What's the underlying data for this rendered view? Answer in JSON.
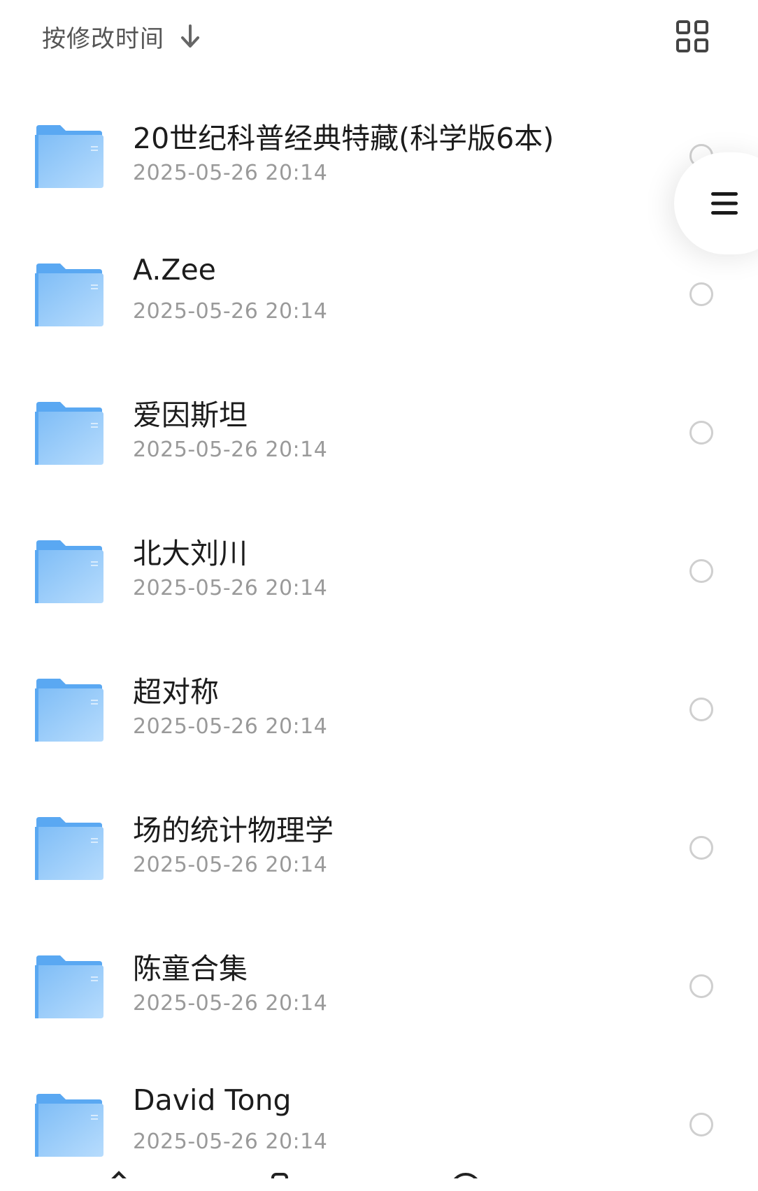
{
  "sort": {
    "label": "按修改时间",
    "direction_icon": "arrow-down-icon"
  },
  "toolbar": {
    "view_toggle_icon": "grid-view-icon"
  },
  "side_menu": {
    "icon": "hamburger-menu-icon"
  },
  "colors": {
    "folder_front_top": "#7fbdf6",
    "folder_front_bottom": "#b7dcfd",
    "folder_back": "#5aa8f2",
    "radio_border": "#cfcfcf",
    "date_text": "#9a9a9a"
  },
  "files": [
    {
      "name": "20世纪科普经典特藏(科学版6本)",
      "date": "2025-05-26 20:14",
      "icon": "folder-icon"
    },
    {
      "name": "A.Zee",
      "date": "2025-05-26 20:14",
      "icon": "folder-icon"
    },
    {
      "name": "爱因斯坦",
      "date": "2025-05-26 20:14",
      "icon": "folder-icon"
    },
    {
      "name": "北大刘川",
      "date": "2025-05-26 20:14",
      "icon": "folder-icon"
    },
    {
      "name": "超对称",
      "date": "2025-05-26 20:14",
      "icon": "folder-icon"
    },
    {
      "name": "场的统计物理学",
      "date": "2025-05-26 20:14",
      "icon": "folder-icon"
    },
    {
      "name": "陈童合集",
      "date": "2025-05-26 20:14",
      "icon": "folder-icon"
    },
    {
      "name": "David Tong",
      "date": "2025-05-26 20:14",
      "icon": "folder-icon"
    }
  ]
}
